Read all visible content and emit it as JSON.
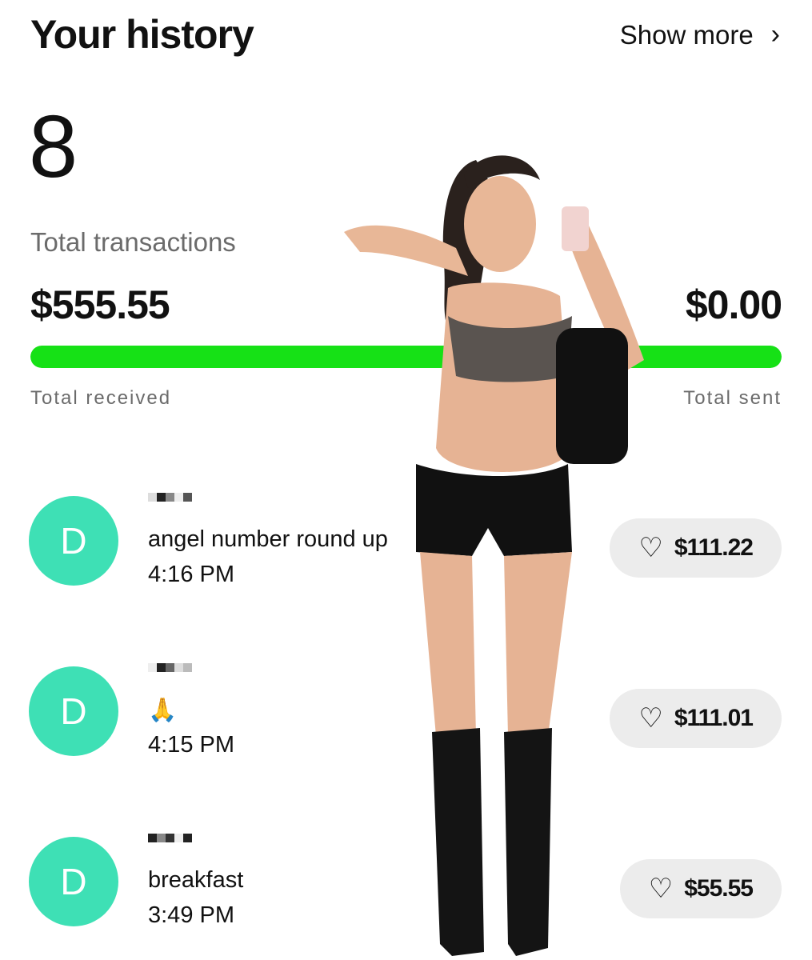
{
  "header": {
    "title": "Your history",
    "show_more": "Show more",
    "chevron_icon": "chevron-right-icon"
  },
  "summary": {
    "count": "8",
    "count_label": "Total transactions",
    "received_amount": "$555.55",
    "sent_amount": "$0.00",
    "received_label": "Total received",
    "sent_label": "Total sent",
    "received_fraction": 1.0,
    "bar_color": "#16e116"
  },
  "transactions": [
    {
      "avatar_letter": "D",
      "memo": "angel number round up",
      "time": "4:16 PM",
      "amount": "$111.22",
      "reaction_icon": "heart-outline-icon"
    },
    {
      "avatar_letter": "D",
      "memo": "🙏",
      "time": "4:15 PM",
      "amount": "$111.01",
      "reaction_icon": "heart-outline-icon"
    },
    {
      "avatar_letter": "D",
      "memo": "breakfast",
      "time": "3:49 PM",
      "amount": "$55.55",
      "reaction_icon": "heart-outline-icon"
    }
  ],
  "colors": {
    "avatar": "#3ee0b5",
    "pill": "#ececec",
    "muted_text": "#6b6b6b"
  }
}
